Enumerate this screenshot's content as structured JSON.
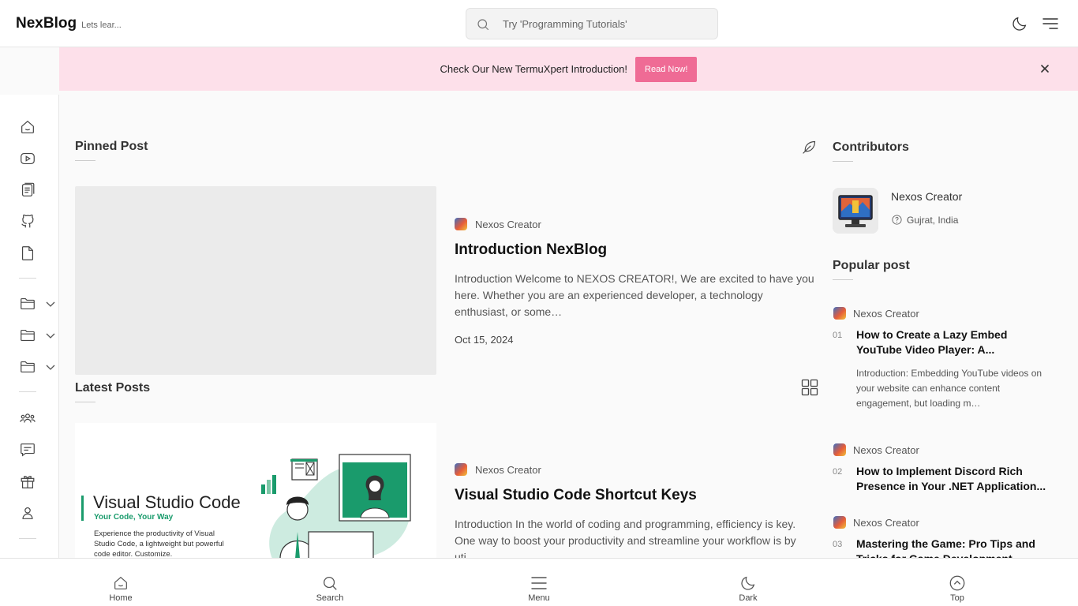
{
  "header": {
    "brand": "NexBlog",
    "tagline": "Lets lear...",
    "search_placeholder": "Try 'Programming Tutorials'"
  },
  "announcement": {
    "text": "Check Our New TermuXpert Introduction!",
    "button": "Read Now!"
  },
  "pinned": {
    "section_title": "Pinned Post",
    "author": "Nexos Creator",
    "title": "Introduction NexBlog",
    "excerpt": "Introduction Welcome to NEXOS CREATOR!, We are excited to have you here. Whether you are an experienced developer, a technology enthusiast, or some…",
    "date": "Oct 15, 2024"
  },
  "latest": {
    "section_title": "Latest Posts",
    "posts": [
      {
        "author": "Nexos Creator",
        "title": "Visual Studio Code Shortcut Keys",
        "excerpt": "Introduction In the world of coding and programming, efficiency is key. One way to boost your productivity and streamline your workflow is by uti…",
        "image": {
          "heading": "Visual Studio Code",
          "subheading": "Your Code, Your Way",
          "body": "Experience the productivity of Visual Studio Code, a lightweight but powerful code editor. Customize."
        }
      }
    ]
  },
  "contributors": {
    "section_title": "Contributors",
    "name": "Nexos Creator",
    "location": "Gujrat, India"
  },
  "popular": {
    "section_title": "Popular post",
    "items": [
      {
        "author": "Nexos Creator",
        "num": "01",
        "title": "How to Create a Lazy Embed YouTube Video Player: A...",
        "excerpt": "Introduction: Embedding YouTube videos on your website can enhance content engagement, but loading m…"
      },
      {
        "author": "Nexos Creator",
        "num": "02",
        "title": "How to Implement Discord Rich Presence in Your .NET Application..."
      },
      {
        "author": "Nexos Creator",
        "num": "03",
        "title": "Mastering the Game: Pro Tips and Tricks for Game Development"
      }
    ]
  },
  "bottom_nav": {
    "home": "Home",
    "search": "Search",
    "menu": "Menu",
    "dark": "Dark",
    "top": "Top"
  },
  "colors": {
    "accent": "#ef6b95",
    "banner_bg": "#fde0ea",
    "vscode_green": "#1a9b6c"
  }
}
